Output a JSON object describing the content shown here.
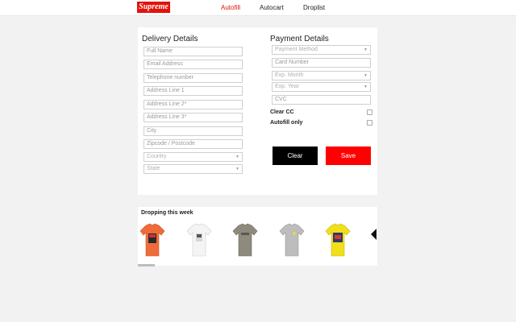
{
  "header": {
    "logo": "Supreme",
    "nav": [
      "Autofill",
      "Autocart",
      "Droplist"
    ],
    "active_nav": "Autofill"
  },
  "delivery": {
    "title": "Delivery Details",
    "fields": [
      "Full Name",
      "Email Address",
      "Telephone number",
      "Address Line 1",
      "Address Line 2*",
      "Address Line 3*",
      "City",
      "Zipcode / Postcode"
    ],
    "selects": [
      "Country",
      "State"
    ]
  },
  "payment": {
    "title": "Payment Details",
    "payment_method": "Payment Method",
    "card_number": "Card Number",
    "exp_month": "Exp. Month",
    "exp_year": "Exp. Year",
    "cvc": "CVC",
    "clear_cc_label": "Clear CC",
    "autofill_only_label": "Autofill only"
  },
  "buttons": {
    "clear": "Clear",
    "save": "Save"
  },
  "droplist": {
    "title": "Dropping this week",
    "items": [
      {
        "icon": "tshirt-icon",
        "color": "#ef6b3a"
      },
      {
        "icon": "tshirt-icon",
        "color": "#f4f4f4"
      },
      {
        "icon": "tshirt-icon",
        "color": "#8e8a7e"
      },
      {
        "icon": "tshirt-icon",
        "color": "#bdbdbd"
      },
      {
        "icon": "tshirt-icon",
        "color": "#f1df1a"
      }
    ]
  },
  "colors": {
    "brand": "#e3120b",
    "save": "#ff0000",
    "clear": "#000000"
  }
}
